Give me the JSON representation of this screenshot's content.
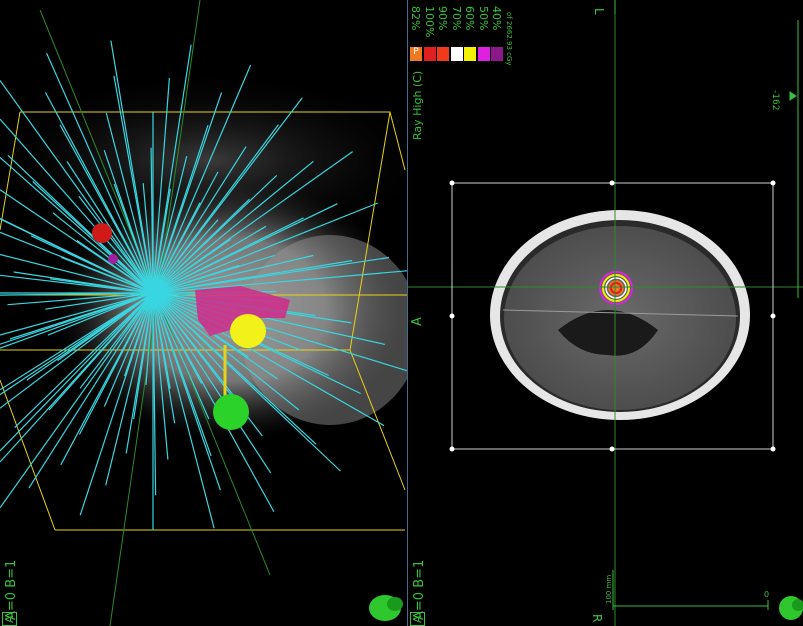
{
  "left_view": {
    "corner_label": "A=0 B=1",
    "letter_badge": "A"
  },
  "right_view": {
    "corner_label": "A=0 B=1",
    "letter_badge": "A",
    "orientation_top": "L",
    "orientation_left": "A",
    "orientation_bottom": "R",
    "side_tick": "-162",
    "scale_label": "100 mm",
    "scale_zero": "0"
  },
  "dose_legend": {
    "title": "Ray High (C)",
    "header_badge": "P",
    "footer": "of 2662.93 cGy",
    "levels": [
      {
        "pct": "82%",
        "color": "#f07a20"
      },
      {
        "pct": "100%",
        "color": "#e02020"
      },
      {
        "pct": "90%",
        "color": "#f03a1a"
      },
      {
        "pct": "70%",
        "color": "#ffffff"
      },
      {
        "pct": "60%",
        "color": "#f2f200"
      },
      {
        "pct": "50%",
        "color": "#e020e0"
      },
      {
        "pct": "40%",
        "color": "#8a1a8a"
      }
    ]
  },
  "icons": {
    "left_head_model": "head-3d-icon",
    "right_head_model": "head-3d-icon"
  }
}
